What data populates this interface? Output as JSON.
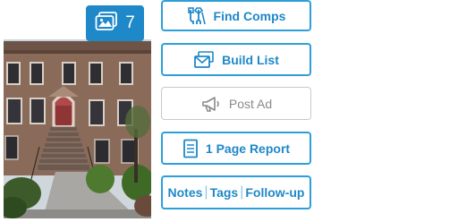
{
  "photo_counter": {
    "icon": "photos-icon",
    "count": "7",
    "color": "#1e88c8"
  },
  "actions": {
    "find_comps": {
      "label": "Find Comps",
      "icon": "map-pin-icon"
    },
    "build_list": {
      "label": "Build List",
      "icon": "mail-stack-icon"
    },
    "post_ad": {
      "label": "Post Ad",
      "icon": "megaphone-icon",
      "state": "disabled"
    },
    "report": {
      "label": "1 Page Report",
      "icon": "document-icon"
    },
    "notes_bar": {
      "notes": "Notes",
      "separator": "|",
      "tags": "Tags",
      "followup": "Follow-up"
    }
  },
  "colors": {
    "accent": "#1e88c8",
    "border": "#2d9fd8",
    "disabled": "#8a8a8a"
  }
}
